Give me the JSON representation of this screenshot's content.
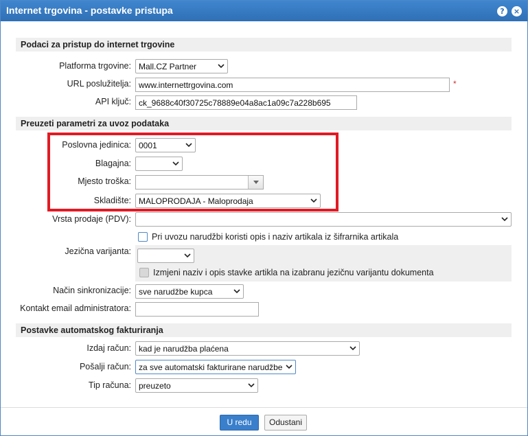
{
  "window": {
    "title": "Internet trgovina - postavke pristupa",
    "help": "?",
    "close": "×"
  },
  "sections": {
    "access": "Podaci za pristup do internet trgovine",
    "import": "Preuzeti parametri za uvoz podataka",
    "invoicing": "Postavke automatskog fakturiranja"
  },
  "access": {
    "platform_label": "Platforma trgovine:",
    "platform_value": "Mall.CZ Partner",
    "url_label": "URL poslužitelja:",
    "url_value": "www.internettrgovina.com",
    "url_required": "*",
    "api_label": "API ključ:",
    "api_value": "ck_9688c40f30725c78889e04a8ac1a09c7a228b695"
  },
  "import": {
    "unit_label": "Poslovna jedinica:",
    "unit_value": "0001",
    "cash_label": "Blagajna:",
    "cash_value": "",
    "cost_label": "Mjesto troška:",
    "cost_value": "",
    "warehouse_label": "Skladište:",
    "warehouse_value": "MALOPRODAJA - Maloprodaja",
    "sale_type_label": "Vrsta prodaje (PDV):",
    "sale_type_value": "",
    "use_description_label": "Pri uvozu narudžbi koristi opis i naziv artikala iz šifrarnika artikala",
    "use_description_checked": false,
    "language_label": "Jezična varijanta:",
    "language_value": "",
    "change_name_label": "Izmjeni naziv i opis stavke artikla na izabranu jezičnu varijantu dokumenta",
    "change_name_checked": false,
    "sync_label": "Način sinkronizacije:",
    "sync_value": "sve narudžbe kupca",
    "admin_email_label": "Kontakt email administratora:",
    "admin_email_value": ""
  },
  "invoicing": {
    "issue_label": "Izdaj račun:",
    "issue_value": "kad je narudžba plaćena",
    "send_label": "Pošalji račun:",
    "send_value": "za sve automatski fakturirane narudžbe",
    "type_label": "Tip računa:",
    "type_value": "preuzeto"
  },
  "buttons": {
    "ok": "U redu",
    "cancel": "Odustani"
  },
  "colors": {
    "titlebar": "#3378c0",
    "highlight": "#e21a24",
    "primary": "#3a7fcb"
  }
}
